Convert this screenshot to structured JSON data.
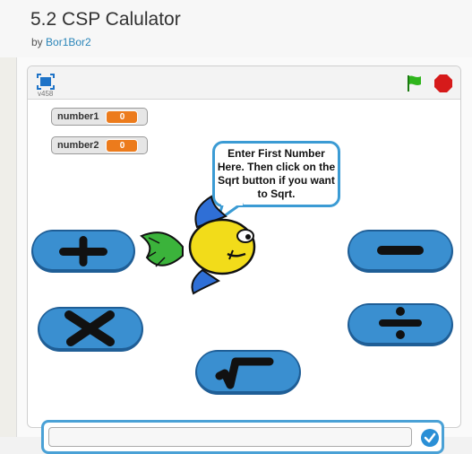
{
  "project": {
    "title": "5.2 CSP Calulator",
    "by_label": "by",
    "author": "Bor1Bor2"
  },
  "player": {
    "version": "v458"
  },
  "monitors": [
    {
      "name": "number1",
      "value": "0"
    },
    {
      "name": "number2",
      "value": "0"
    }
  ],
  "speech": {
    "text": "Enter First Number Here. Then click on the Sqrt button if you want to Sqrt."
  },
  "buttons": {
    "add": "plus-icon",
    "subtract": "minus-icon",
    "multiply": "times-icon",
    "divide": "divide-icon",
    "sqrt": "sqrt-icon"
  },
  "answer": {
    "value": ""
  },
  "colors": {
    "accent": "#3b9bd4",
    "button_fill": "#3a8fd0",
    "monitor_value": "#ec7b1c",
    "flag": "#2fb51c",
    "stop": "#d61a1a"
  }
}
